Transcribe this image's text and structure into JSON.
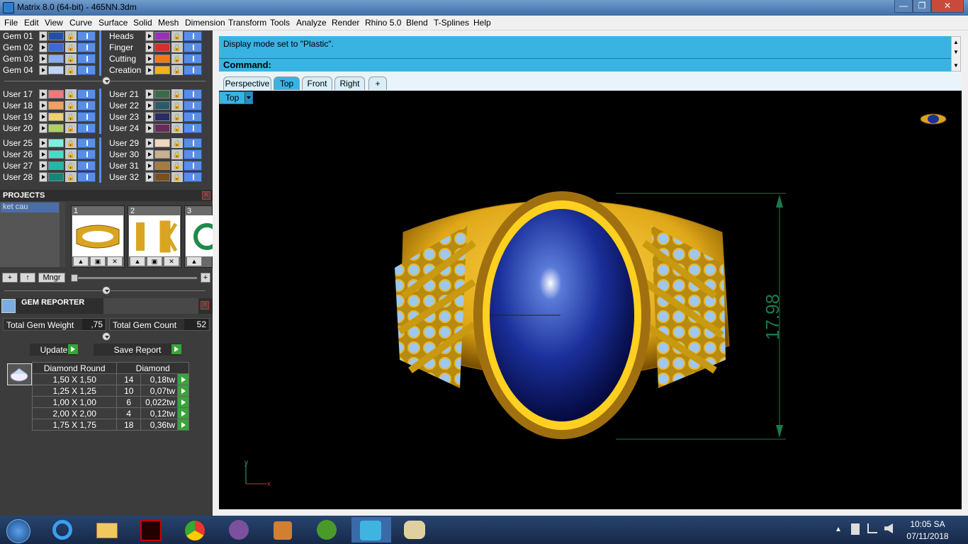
{
  "window": {
    "title": "Matrix 8.0 (64-bit) - 465NN.3dm",
    "min": "—",
    "max": "❐",
    "close": "✕"
  },
  "menu": [
    "File",
    "Edit",
    "View",
    "Curve",
    "Surface",
    "Solid",
    "Mesh",
    "Dimension",
    "Transform",
    "Tools",
    "Analyze",
    "Render",
    "Rhino 5.0",
    "Blend",
    "T-Splines",
    "Help"
  ],
  "layers_top": [
    {
      "name": "Gem 01",
      "color": "#1f4fa8"
    },
    {
      "name": "Gem 02",
      "color": "#3a6ad8"
    },
    {
      "name": "Gem 03",
      "color": "#86aef0"
    },
    {
      "name": "Gem 04",
      "color": "#c0d4f6"
    },
    {
      "name": "Heads",
      "color": "#9a2fb8"
    },
    {
      "name": "Finger",
      "color": "#d03030"
    },
    {
      "name": "Cutting",
      "color": "#f07a1a"
    },
    {
      "name": "Creation",
      "color": "#f2b21a"
    }
  ],
  "layers_users_a": [
    {
      "name": "User 17",
      "color": "#f07878"
    },
    {
      "name": "User 18",
      "color": "#f0a060"
    },
    {
      "name": "User 19",
      "color": "#f0d070"
    },
    {
      "name": "User 20",
      "color": "#b0d060"
    },
    {
      "name": "User 21",
      "color": "#3a6a4a"
    },
    {
      "name": "User 22",
      "color": "#2a5a6a"
    },
    {
      "name": "User 23",
      "color": "#2a2a6a"
    },
    {
      "name": "User 24",
      "color": "#6a2a5a"
    }
  ],
  "layers_users_b": [
    {
      "name": "User 25",
      "color": "#7ef0e0"
    },
    {
      "name": "User 26",
      "color": "#40e0c8"
    },
    {
      "name": "User 27",
      "color": "#20b8a8"
    },
    {
      "name": "User 28",
      "color": "#108878"
    },
    {
      "name": "User 29",
      "color": "#f0d8c0"
    },
    {
      "name": "User 30",
      "color": "#c8b090"
    },
    {
      "name": "User 31",
      "color": "#a87a40"
    },
    {
      "name": "User 32",
      "color": "#7a5020"
    }
  ],
  "projects": {
    "header": "PROJECTS",
    "items": [
      "ket cau"
    ],
    "thumbs": [
      "1",
      "2",
      "3"
    ],
    "mngr_label": "Mngr",
    "add": "+",
    "up": "↑"
  },
  "gem_reporter": {
    "header": "GEM REPORTER",
    "weight_label": "Total Gem Weight",
    "weight_value": ",75",
    "count_label": "Total Gem Count",
    "count_value": "52",
    "update_label": "Update",
    "save_label": "Save Report",
    "col_shape": "Diamond Round",
    "col_material": "Diamond",
    "rows": [
      {
        "size": "1,50 X 1,50",
        "qty": "14",
        "weight": "0,18tw"
      },
      {
        "size": "1,25 X 1,25",
        "qty": "10",
        "weight": "0,07tw"
      },
      {
        "size": "1,00 X 1,00",
        "qty": "6",
        "weight": "0,022tw"
      },
      {
        "size": "2,00 X 2,00",
        "qty": "4",
        "weight": "0,12tw"
      },
      {
        "size": "1,75 X 1,75",
        "qty": "18",
        "weight": "0,36tw"
      }
    ]
  },
  "command": {
    "history": "Display mode set to \"Plastic\".",
    "prompt": "Command:"
  },
  "tabs": [
    {
      "label": "Perspective",
      "active": false
    },
    {
      "label": "Top",
      "active": true
    },
    {
      "label": "Front",
      "active": false
    },
    {
      "label": "Right",
      "active": false
    },
    {
      "label": "+",
      "active": false
    }
  ],
  "viewport": {
    "label": "Top",
    "dimension": "17.98",
    "axis_x": "x",
    "axis_y": "y",
    "dim_color": "#1a7a4a"
  },
  "taskbar": {
    "time": "10:05 SA",
    "date": "07/11/2018"
  }
}
